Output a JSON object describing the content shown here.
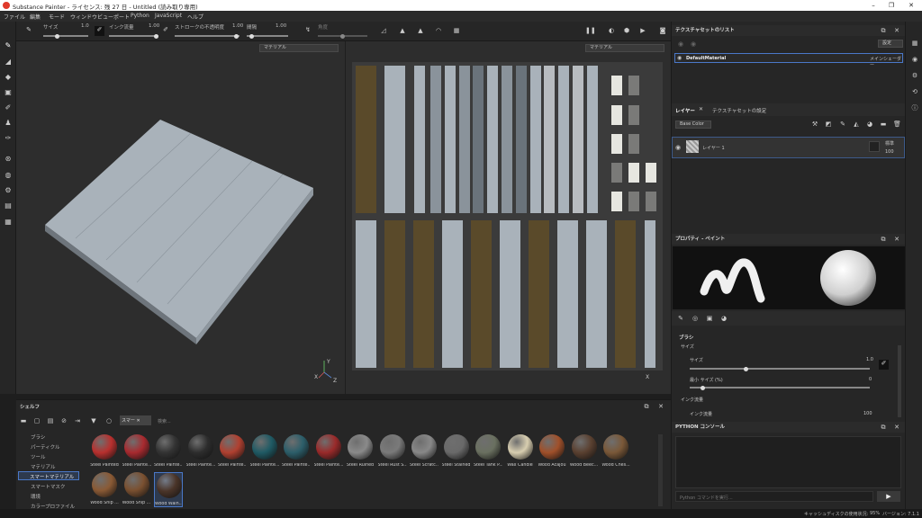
{
  "window": {
    "title": "Substance Painter - ライセンス: 残 27 日 - Untitled (読み取り専用)"
  },
  "menu": [
    "ファイル",
    "編集",
    "モード",
    "ウィンドウ",
    "ビューポート",
    "Python",
    "JavaScript",
    "ヘルプ"
  ],
  "toolbar": {
    "size_label": "サイズ",
    "size_value": "1.0",
    "ink_label": "インク流量",
    "ink_value": "1.00",
    "stroke_label": "ストロークの不透明度",
    "stroke_value": "1.00",
    "spacing_label": "間隔",
    "spacing_value": "1.00",
    "angle_label": "角度"
  },
  "viewport": {
    "material_select_left": "マテリアル",
    "material_select_right": "マテリアル"
  },
  "texture_set_list": {
    "title": "テクスチャセットのリスト",
    "settings_label": "設定",
    "item_name": "DefaultMaterial",
    "item_shader": "メインシェーダー"
  },
  "layers": {
    "tab_layers": "レイヤー",
    "tab_settings": "テクスチャセットの設定",
    "channel_select": "Base Color",
    "layer_name": "レイヤー 1",
    "blend_mode": "標準",
    "opacity": "100"
  },
  "properties": {
    "title": "プロパティ - ペイント",
    "brush_section": "ブラシ",
    "size_group": "サイズ",
    "size_label": "サイズ",
    "size_value": "1.0",
    "min_size_label": "最小 サイズ (%)",
    "min_size_value": "0",
    "ink_group": "インク流量",
    "ink_label": "インク流量",
    "ink_value": "100"
  },
  "python_console": {
    "title": "PYTHON コンソール",
    "placeholder": "Python コマンドを実行..."
  },
  "shelf": {
    "title": "シェルフ",
    "filter_tag": "スマー",
    "search_placeholder": "検索...",
    "categories": [
      "ブラシ",
      "パーティクル",
      "ツール",
      "マテリアル",
      "スマートマテリアル",
      "スマートマスク",
      "環境",
      "カラープロファイル"
    ],
    "selected_category": "スマートマテリアル",
    "materials": [
      {
        "name": "Steel Painted",
        "color": "#b8302e"
      },
      {
        "name": "Steel Painte...",
        "color": "#a82a2f"
      },
      {
        "name": "Steel Painte...",
        "color": "#333333"
      },
      {
        "name": "Steel Painte...",
        "color": "#2d2d2d"
      },
      {
        "name": "Steel Painte...",
        "color": "#b04030"
      },
      {
        "name": "Steel Painte...",
        "color": "#1f5a64"
      },
      {
        "name": "Steel Painte...",
        "color": "#2c5e6a"
      },
      {
        "name": "Steel Painte...",
        "color": "#9a2a2a"
      },
      {
        "name": "Steel Ruined",
        "color": "#8a8a8a"
      },
      {
        "name": "Steel Rust S...",
        "color": "#7a7a7a"
      },
      {
        "name": "Steel Scratc...",
        "color": "#888888"
      },
      {
        "name": "Steel Stained",
        "color": "#6a6a6a"
      },
      {
        "name": "Steel Tank P...",
        "color": "#6a7060"
      },
      {
        "name": "Wax Candle",
        "color": "#d8ceb0"
      },
      {
        "name": "Wood Acajou",
        "color": "#a0502a"
      },
      {
        "name": "Wood Beec...",
        "color": "#5a4030"
      },
      {
        "name": "Wood Ches...",
        "color": "#7a5838"
      },
      {
        "name": "Wood Ship ...",
        "color": "#8a5a35"
      },
      {
        "name": "Wood Ship ...",
        "color": "#7a5030"
      },
      {
        "name": "Wood Walh...",
        "color": "#4a3428"
      }
    ]
  },
  "status": {
    "cache": "キャッシュディスクの使用状況:",
    "cache_value": "95%",
    "version": "バージョン: 7.1.1"
  },
  "axes": {
    "y": "Y",
    "x": "X",
    "z": "Z"
  }
}
